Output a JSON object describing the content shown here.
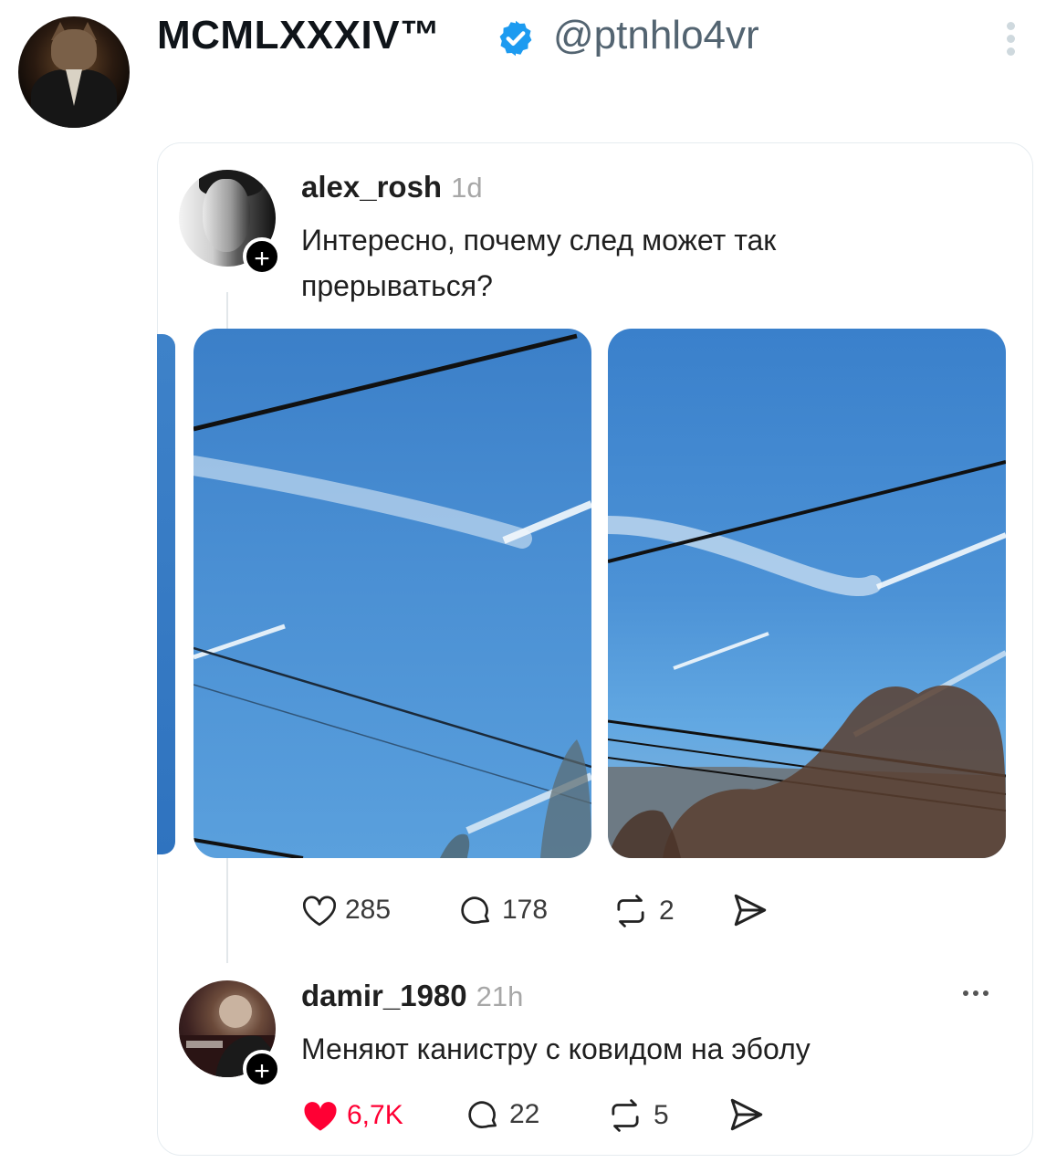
{
  "author": {
    "display_name": "MCMLXXXIV™",
    "handle": "@ptnhlo4vr",
    "verified": true,
    "verified_color": "#1d9bf0"
  },
  "quoted_post": {
    "username": "alex_rosh",
    "time": "1d",
    "text": "Интересно, почему след может так прерываться?",
    "actions": {
      "likes": "285",
      "replies": "178",
      "reposts": "2"
    }
  },
  "reply": {
    "username": "damir_1980",
    "time": "21h",
    "text": "Меняют канистру с ковидом на эболу",
    "actions": {
      "likes": "6,7K",
      "liked": true,
      "like_color": "#ff0034",
      "replies": "22",
      "reposts": "5"
    }
  },
  "icons": [
    "verified-badge-icon",
    "more-vertical-icon",
    "follow-plus-icon",
    "heart-icon",
    "comment-icon",
    "repost-icon",
    "share-icon",
    "more-horizontal-icon"
  ],
  "colors": {
    "sky_blue": "#4a8fd3",
    "secondary_text": "#536471",
    "border": "#e6ecf0"
  }
}
